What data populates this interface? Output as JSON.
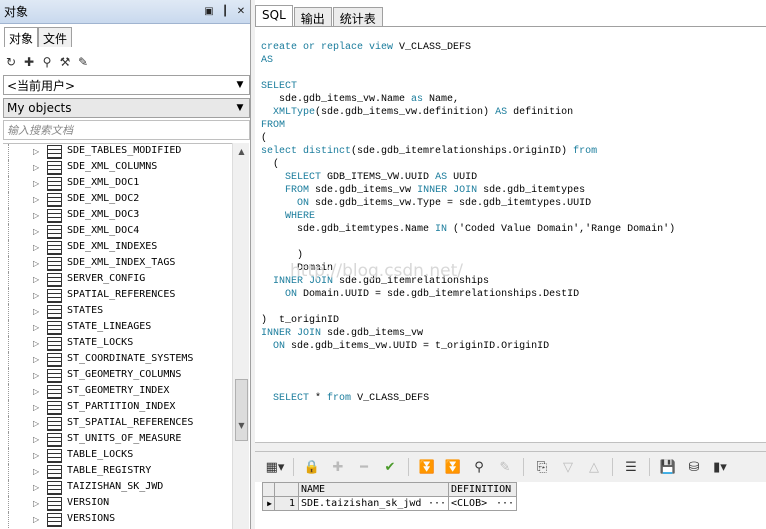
{
  "left_panel": {
    "title": "对象",
    "tabs": [
      "对象",
      "文件"
    ],
    "user_combo": "<当前用户>",
    "objects_combo": "My objects",
    "search_placeholder": "输入搜索文档",
    "tree_items": [
      "SDE_TABLES_MODIFIED",
      "SDE_XML_COLUMNS",
      "SDE_XML_DOC1",
      "SDE_XML_DOC2",
      "SDE_XML_DOC3",
      "SDE_XML_DOC4",
      "SDE_XML_INDEXES",
      "SDE_XML_INDEX_TAGS",
      "SERVER_CONFIG",
      "SPATIAL_REFERENCES",
      "STATES",
      "STATE_LINEAGES",
      "STATE_LOCKS",
      "ST_COORDINATE_SYSTEMS",
      "ST_GEOMETRY_COLUMNS",
      "ST_GEOMETRY_INDEX",
      "ST_PARTITION_INDEX",
      "ST_SPATIAL_REFERENCES",
      "ST_UNITS_OF_MEASURE",
      "TABLE_LOCKS",
      "TABLE_REGISTRY",
      "TAIZISHAN_SK_JWD",
      "VERSION",
      "VERSIONS"
    ]
  },
  "editor_tabs": [
    "SQL",
    "输出",
    "统计表"
  ],
  "watermark": "http://blog.csdn.net/",
  "result_grid": {
    "headers": [
      "NAME",
      "DEFINITION"
    ],
    "rows": [
      {
        "num": "1",
        "name": "SDE.taizishan_sk_jwd",
        "name_btn": "···",
        "definition": "<CLOB>",
        "def_btn": "···"
      }
    ]
  }
}
